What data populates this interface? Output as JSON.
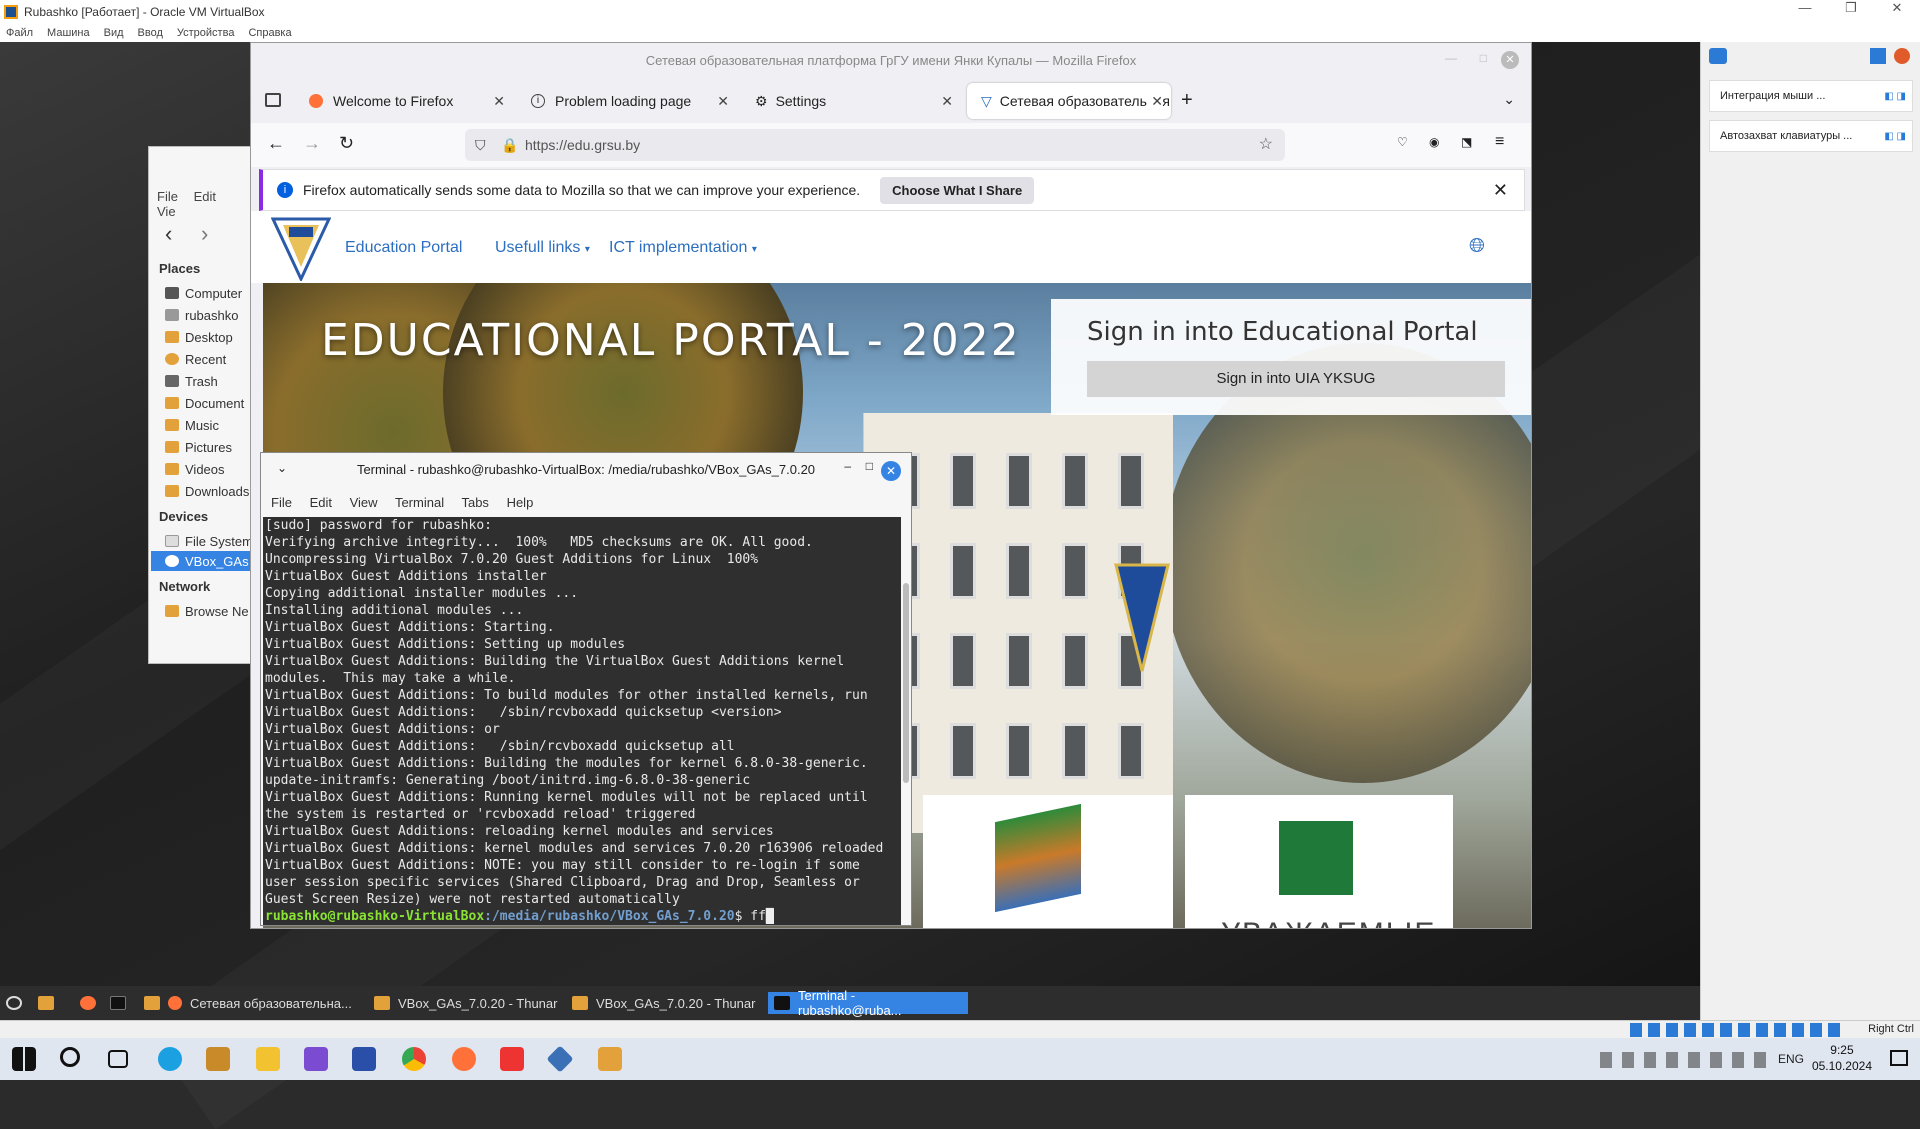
{
  "host": {
    "title": "Rubashko [Работает] - Oracle VM VirtualBox",
    "menu": [
      "Файл",
      "Машина",
      "Вид",
      "Ввод",
      "Устройства",
      "Справка"
    ],
    "side_items": [
      "Интеграция мыши ...",
      "Автозахват клавиатуры ..."
    ],
    "status_right": "Right Ctrl"
  },
  "thunar": {
    "menu": [
      "File",
      "Edit",
      "Vie"
    ],
    "sections": {
      "places": "Places",
      "devices": "Devices",
      "network": "Network"
    },
    "places": [
      "Computer",
      "rubashko",
      "Desktop",
      "Recent",
      "Trash",
      "Document",
      "Music",
      "Pictures",
      "Videos",
      "Downloads"
    ],
    "devices": [
      "File System",
      "VBox_GAs"
    ],
    "network": [
      "Browse Ne"
    ]
  },
  "firefox": {
    "window_title": "Сетевая образовательная платформа ГрГУ имени Янки Купалы — Mozilla Firefox",
    "tabs": [
      {
        "label": "Welcome to Firefox"
      },
      {
        "label": "Problem loading page"
      },
      {
        "label": "Settings"
      },
      {
        "label": "Сетевая образовательная"
      }
    ],
    "url": "https://edu.grsu.by",
    "notice": {
      "text": "Firefox automatically sends some data to Mozilla so that we can improve your experience.",
      "button": "Choose What I Share"
    },
    "site": {
      "nav": [
        "Education Portal",
        "Usefull links",
        "ICT implementation"
      ],
      "hero_title": "EDUCATIONAL PORTAL - 2022",
      "signin_heading": "Sign in into Educational Portal",
      "signin_button": "Sign in into UIA YKSUG",
      "card_text": "УВАЖАЕМЫЕ"
    }
  },
  "terminal": {
    "title": "Terminal - rubashko@rubashko-VirtualBox: /media/rubashko/VBox_GAs_7.0.20",
    "menu": [
      "File",
      "Edit",
      "View",
      "Terminal",
      "Tabs",
      "Help"
    ],
    "lines": [
      "[sudo] password for rubashko:",
      "Verifying archive integrity...  100%   MD5 checksums are OK. All good.",
      "Uncompressing VirtualBox 7.0.20 Guest Additions for Linux  100%",
      "VirtualBox Guest Additions installer",
      "Copying additional installer modules ...",
      "Installing additional modules ...",
      "VirtualBox Guest Additions: Starting.",
      "VirtualBox Guest Additions: Setting up modules",
      "VirtualBox Guest Additions: Building the VirtualBox Guest Additions kernel",
      "modules.  This may take a while.",
      "VirtualBox Guest Additions: To build modules for other installed kernels, run",
      "VirtualBox Guest Additions:   /sbin/rcvboxadd quicksetup <version>",
      "VirtualBox Guest Additions: or",
      "VirtualBox Guest Additions:   /sbin/rcvboxadd quicksetup all",
      "VirtualBox Guest Additions: Building the modules for kernel 6.8.0-38-generic.",
      "update-initramfs: Generating /boot/initrd.img-6.8.0-38-generic",
      "VirtualBox Guest Additions: Running kernel modules will not be replaced until",
      "the system is restarted or 'rcvboxadd reload' triggered",
      "VirtualBox Guest Additions: reloading kernel modules and services",
      "VirtualBox Guest Additions: kernel modules and services 7.0.20 r163906 reloaded",
      "VirtualBox Guest Additions: NOTE: you may still consider to re-login if some",
      "user session specific services (Shared Clipboard, Drag and Drop, Seamless or",
      "Guest Screen Resize) were not restarted automatically"
    ],
    "prompt_user": "rubashko@rubashko-VirtualBox",
    "prompt_path": ":/media/rubashko/VBox_GAs_7.0.20",
    "prompt_input": "$ ff"
  },
  "guest_taskbar": {
    "items": [
      "Сетевая образовательна...",
      "VBox_GAs_7.0.20 - Thunar",
      "VBox_GAs_7.0.20 - Thunar",
      "Terminal - rubashko@ruba..."
    ]
  },
  "windows_taskbar": {
    "lang": "ENG",
    "time": "9:25",
    "date": "05.10.2024"
  },
  "colors": {
    "accent": "#3584e4",
    "link": "#2c6ebf",
    "prompt_green": "#8ae234",
    "prompt_blue": "#729fcf"
  }
}
